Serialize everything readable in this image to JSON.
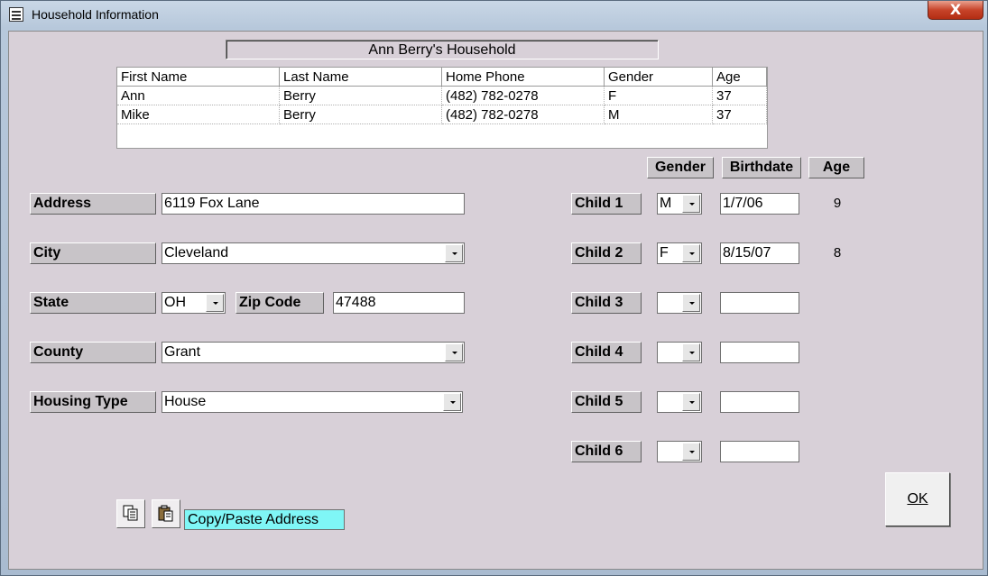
{
  "window": {
    "title": "Household Information",
    "close_label": "X"
  },
  "household_title": "Ann Berry's Household",
  "members_table": {
    "columns": [
      "First Name",
      "Last Name",
      "Home Phone",
      "Gender",
      "Age"
    ],
    "rows": [
      [
        "Ann",
        "Berry",
        "(482) 782-0278",
        "F",
        "37"
      ],
      [
        "Mike",
        "Berry",
        "(482) 782-0278",
        "M",
        "37"
      ]
    ]
  },
  "address_form": {
    "address_label": "Address",
    "address_value": "6119 Fox Lane",
    "city_label": "City",
    "city_value": "Cleveland",
    "state_label": "State",
    "state_value": "OH",
    "zip_label": "Zip Code",
    "zip_value": "47488",
    "county_label": "County",
    "county_value": "Grant",
    "housing_label": "Housing Type",
    "housing_value": "House"
  },
  "children": {
    "gender_header": "Gender",
    "birthdate_header": "Birthdate",
    "age_header": "Age",
    "rows": [
      {
        "label": "Child 1",
        "gender": "M",
        "birthdate": "1/7/06",
        "age": "9"
      },
      {
        "label": "Child 2",
        "gender": "F",
        "birthdate": "8/15/07",
        "age": "8"
      },
      {
        "label": "Child 3",
        "gender": "",
        "birthdate": "",
        "age": ""
      },
      {
        "label": "Child 4",
        "gender": "",
        "birthdate": "",
        "age": ""
      },
      {
        "label": "Child 5",
        "gender": "",
        "birthdate": "",
        "age": ""
      },
      {
        "label": "Child 6",
        "gender": "",
        "birthdate": "",
        "age": ""
      }
    ]
  },
  "copy_paste_label": "Copy/Paste Address",
  "ok_label": "OK",
  "icons": {
    "copy": "copy-icon",
    "paste": "paste-icon",
    "app": "form-icon"
  }
}
